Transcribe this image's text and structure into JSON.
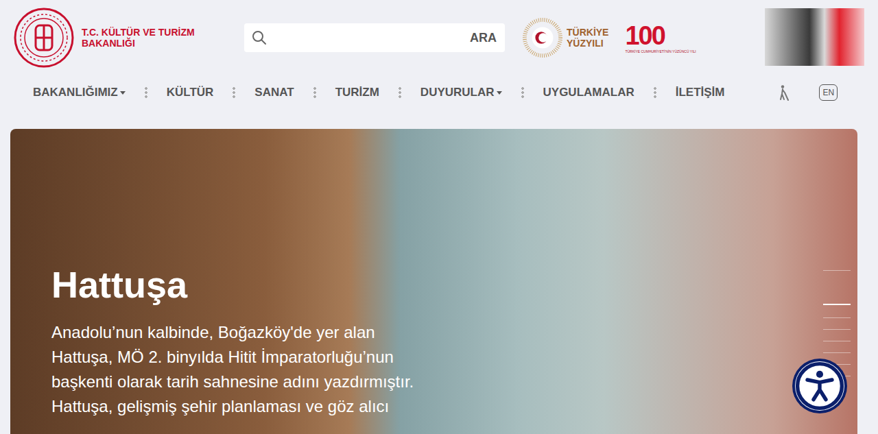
{
  "header": {
    "ministry_logo": {
      "lines": [
        "T.C. KÜLTÜR VE TURİZM",
        "BAKANLIĞI"
      ]
    },
    "search": {
      "button": "ARA"
    },
    "centennial_logo": {
      "words": [
        "TÜRKİYE",
        "YÜZYILI"
      ],
      "number": "100",
      "caption": "TÜRKİYE CUMHURİYETİ'NİN YÜZÜNCÜ YILI"
    }
  },
  "nav": {
    "items": [
      {
        "label": "BAKANLIĞIMIZ",
        "dropdown": true
      },
      {
        "label": "KÜLTÜR",
        "dropdown": false
      },
      {
        "label": "SANAT",
        "dropdown": false
      },
      {
        "label": "TURİZM",
        "dropdown": false
      },
      {
        "label": "DUYURULAR",
        "dropdown": true
      },
      {
        "label": "UYGULAMALAR",
        "dropdown": false
      },
      {
        "label": "İLETİŞİM",
        "dropdown": false
      }
    ],
    "language": "EN"
  },
  "hero": {
    "title": "Hattuşa",
    "text": "Anadolu’nun kalbinde, Boğazköy'de yer alan Hattuşa, MÖ 2. binyılda Hitit İmparatorluğu’nun başkenti olarak tarih sahnesine adını yazdırmıştır. Hattuşa, gelişmiş şehir planlaması ve göz alıcı",
    "slides": [
      {
        "selected": false
      },
      {
        "selected": true
      },
      {
        "selected": false
      },
      {
        "selected": false
      },
      {
        "selected": false
      },
      {
        "selected": false
      },
      {
        "selected": false
      },
      {
        "selected": false
      }
    ]
  }
}
